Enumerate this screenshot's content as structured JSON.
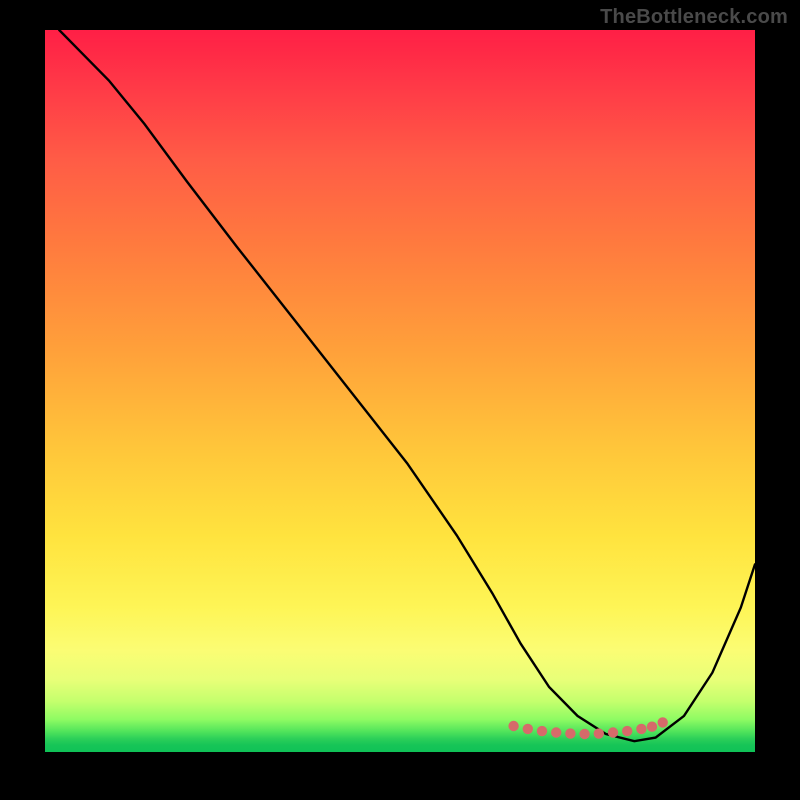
{
  "watermark": "TheBottleneck.com",
  "chart_data": {
    "type": "line",
    "title": "",
    "xlabel": "",
    "ylabel": "",
    "xlim": [
      0,
      100
    ],
    "ylim": [
      0,
      100
    ],
    "grid": false,
    "legend": false,
    "note": "Axis values are normalized 0-100 estimates; no tick labels are visible in the image.",
    "series": [
      {
        "name": "bottleneck-curve",
        "color": "#000000",
        "x": [
          2,
          5,
          9,
          14,
          20,
          27,
          35,
          43,
          51,
          58,
          63,
          67,
          71,
          75,
          79,
          83,
          86,
          90,
          94,
          98,
          100
        ],
        "values": [
          100,
          97,
          93,
          87,
          79,
          70,
          60,
          50,
          40,
          30,
          22,
          15,
          9,
          5,
          2.5,
          1.5,
          2,
          5,
          11,
          20,
          26
        ]
      }
    ],
    "markers": {
      "name": "highlight-dots",
      "color": "#d66a6a",
      "x": [
        66,
        68,
        70,
        72,
        74,
        76,
        78,
        80,
        82,
        84,
        85.5,
        87
      ],
      "values": [
        3.6,
        3.2,
        2.9,
        2.7,
        2.55,
        2.5,
        2.55,
        2.7,
        2.9,
        3.2,
        3.5,
        4.1
      ]
    },
    "background_gradient_stops": [
      {
        "pos": 0,
        "color": "#ff1f46"
      },
      {
        "pos": 30,
        "color": "#ff7b3e"
      },
      {
        "pos": 60,
        "color": "#ffd33c"
      },
      {
        "pos": 82,
        "color": "#fef556"
      },
      {
        "pos": 95,
        "color": "#8efb63"
      },
      {
        "pos": 100,
        "color": "#0fc257"
      }
    ]
  }
}
